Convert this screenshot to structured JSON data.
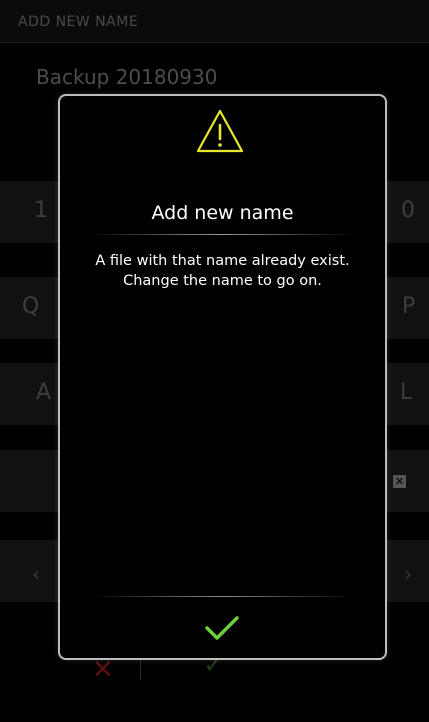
{
  "header": {
    "title": "ADD NEW NAME"
  },
  "name_input": {
    "value": "Backup 20180930"
  },
  "keyboard": {
    "row1_left": "1",
    "row1_right": "0",
    "row2_left": "Q",
    "row2_right": "P",
    "row3_left": "A",
    "row3_right": "L",
    "backspace_icon": "backspace-icon",
    "prev_icon": "chevron-left-icon",
    "next_icon": "chevron-right-icon"
  },
  "footer": {
    "cancel_icon": "cross-icon",
    "confirm_icon": "check-icon",
    "cancel_color": "#5a1010",
    "confirm_color": "#1f3a12"
  },
  "dialog": {
    "icon": "warning-triangle-icon",
    "icon_color": "#e6e62a",
    "title": "Add new name",
    "message": "A file with that name already exist. Change the name to go on.",
    "ok_icon": "check-icon",
    "ok_color": "#6fcf3a"
  }
}
